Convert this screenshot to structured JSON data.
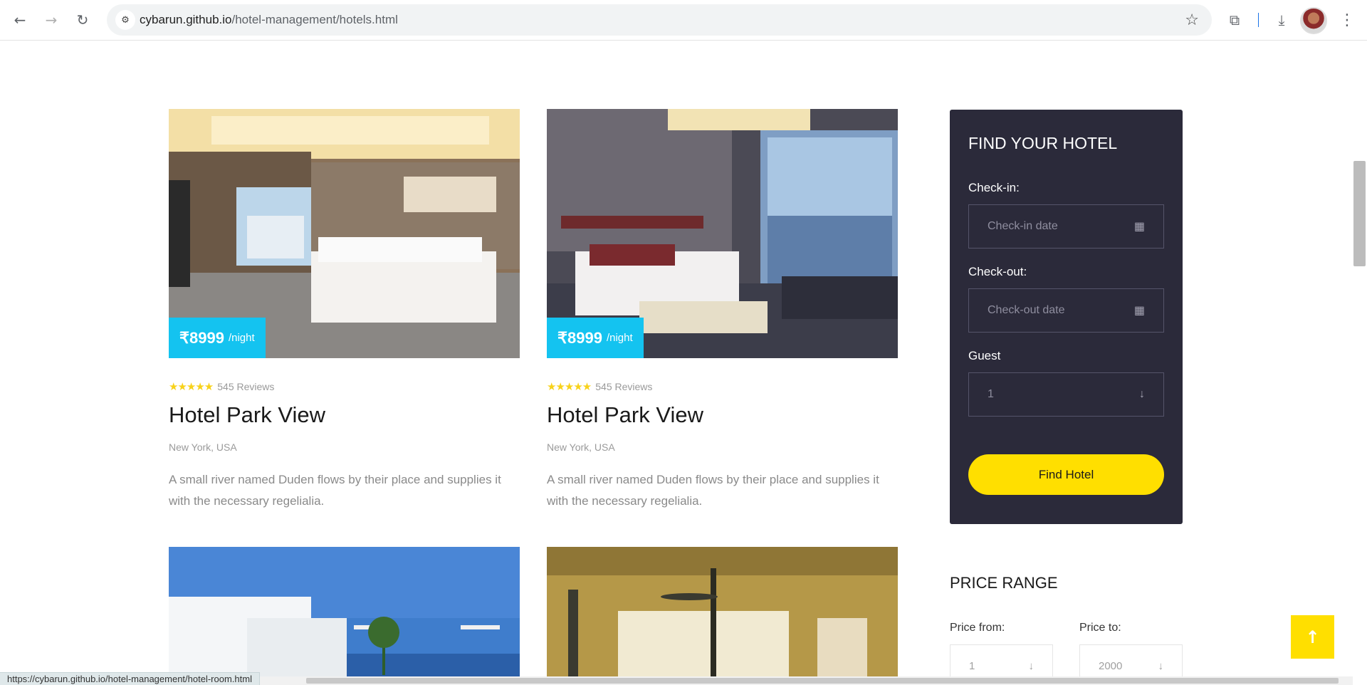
{
  "browser": {
    "url_domain": "cybarun.github.io",
    "url_path": "/hotel-management/hotels.html",
    "status_url": "https://cybarun.github.io/hotel-management/hotel-room.html"
  },
  "hotels": [
    {
      "price": "₹8999",
      "unit": "/night",
      "reviews": "545 Reviews",
      "name": "Hotel Park View",
      "location": "New York, USA",
      "description": "A small river named Duden flows by their place and supplies it with the necessary regelialia."
    },
    {
      "price": "₹8999",
      "unit": "/night",
      "reviews": "545 Reviews",
      "name": "Hotel Park View",
      "location": "New York, USA",
      "description": "A small river named Duden flows by their place and supplies it with the necessary regelialia."
    }
  ],
  "sidebar": {
    "find_title": "FIND YOUR HOTEL",
    "checkin_label": "Check-in:",
    "checkin_placeholder": "Check-in date",
    "checkout_label": "Check-out:",
    "checkout_placeholder": "Check-out date",
    "guest_label": "Guest",
    "guest_value": "1",
    "find_button": "Find Hotel",
    "price_range_title": "PRICE RANGE",
    "price_from_label": "Price from:",
    "price_from_value": "1",
    "price_to_label": "Price to:",
    "price_to_value": "2000"
  }
}
